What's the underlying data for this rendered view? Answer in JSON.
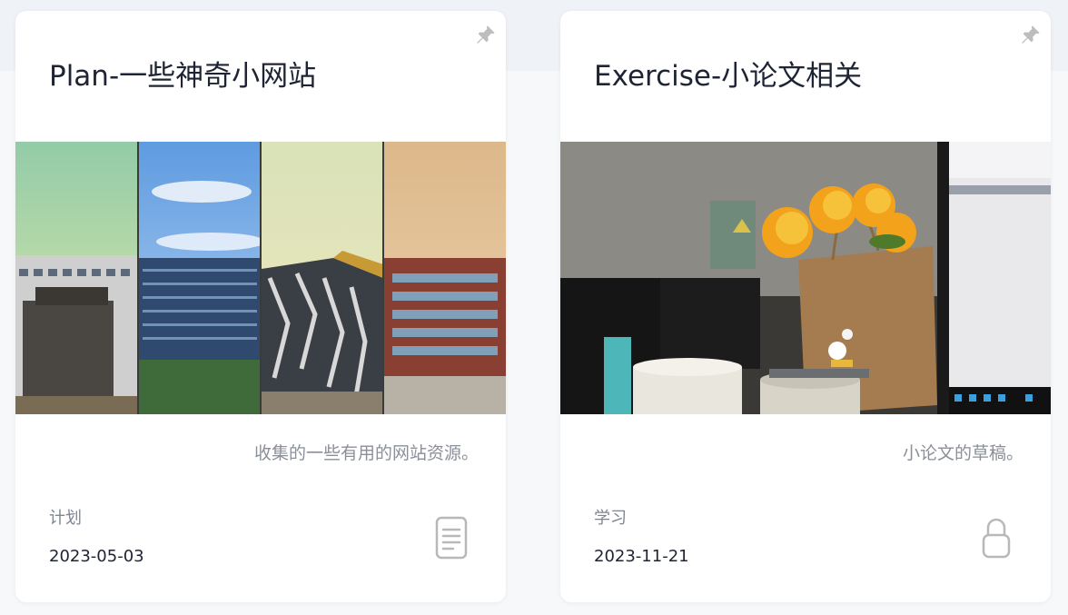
{
  "cards": [
    {
      "title": "Plan-一些神奇小网站",
      "excerpt": "收集的一些有用的网站资源。",
      "category": "计划",
      "date": "2023-05-03",
      "pinned": true,
      "type_icon": "document-icon",
      "cover": "four-panel-campus-buildings-photo"
    },
    {
      "title": "Exercise-小论文相关",
      "excerpt": "小论文的草稿。",
      "category": "学习",
      "date": "2023-11-21",
      "pinned": true,
      "type_icon": "lock-icon",
      "cover": "desk-with-sunflowers-and-monitor-photo"
    }
  ],
  "colors": {
    "title": "#1e2433",
    "muted": "#8a8f98",
    "icon": "#b8b8b8",
    "card": "#ffffff"
  }
}
